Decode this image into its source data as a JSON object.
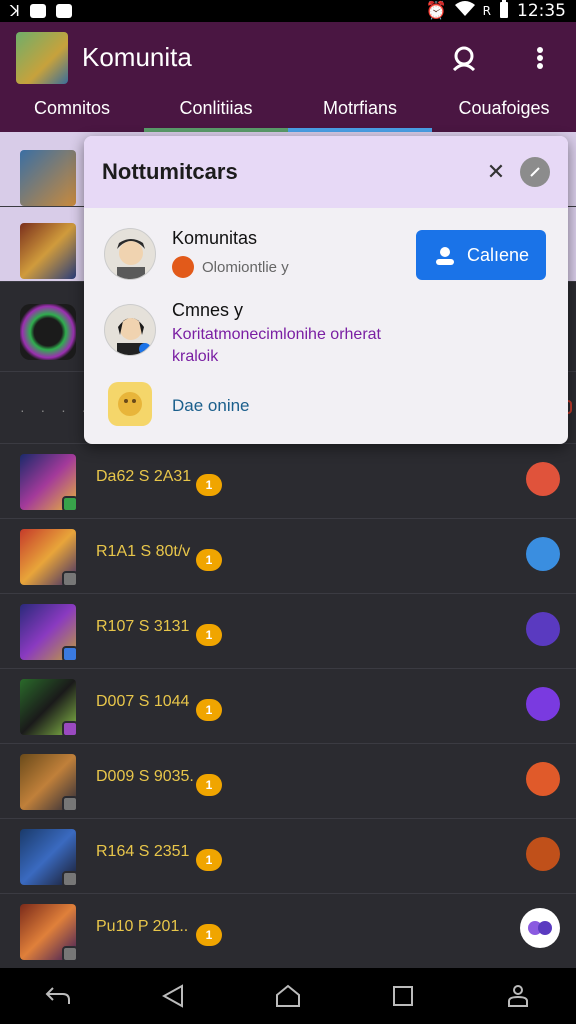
{
  "status_bar": {
    "time": "12:35",
    "signal": "R",
    "icons": [
      "notification-icon",
      "app-icon",
      "message-icon",
      "alarm-icon",
      "wifi-icon",
      "signal-icon",
      "battery-icon"
    ]
  },
  "app": {
    "title": "Komunita",
    "actions": [
      "profile-icon",
      "more-vert-icon"
    ],
    "tabs": [
      {
        "label": "Comnitos"
      },
      {
        "label": "Conlitiias"
      },
      {
        "label": "Motrfians"
      },
      {
        "label": "Couafoiges"
      }
    ]
  },
  "panel": {
    "title": "Nottumitcars",
    "notifications": [
      {
        "name": "Komunitas",
        "subtitle": "Olomiontlie y",
        "button_label": "Calıene"
      },
      {
        "name": "Cmnes y",
        "message": "Koritatmonecimlonihe orherat",
        "message2": "kraloik"
      },
      {
        "link": "Dae onine"
      }
    ]
  },
  "list": {
    "items": [
      {
        "text": "Da62 S 2A31",
        "coin": "1"
      },
      {
        "text": "R1A1 S 80t/v",
        "coin": "1"
      },
      {
        "text": "R107 S 3131",
        "coin": "1"
      },
      {
        "text": "D007 S 1044",
        "coin": "1"
      },
      {
        "text": "D009 S 9035.",
        "coin": "1"
      },
      {
        "text": "R164 S 2351",
        "coin": "1"
      },
      {
        "text": "Pu10 P 201..",
        "coin": "1"
      }
    ]
  },
  "colors": {
    "appbar": "#4a1642",
    "list_bg": "#2b2b30",
    "accent_blue": "#1a73e8",
    "coin": "#f0a500",
    "row_text": "#e8c64a",
    "message_purple": "#7a1fa3"
  }
}
